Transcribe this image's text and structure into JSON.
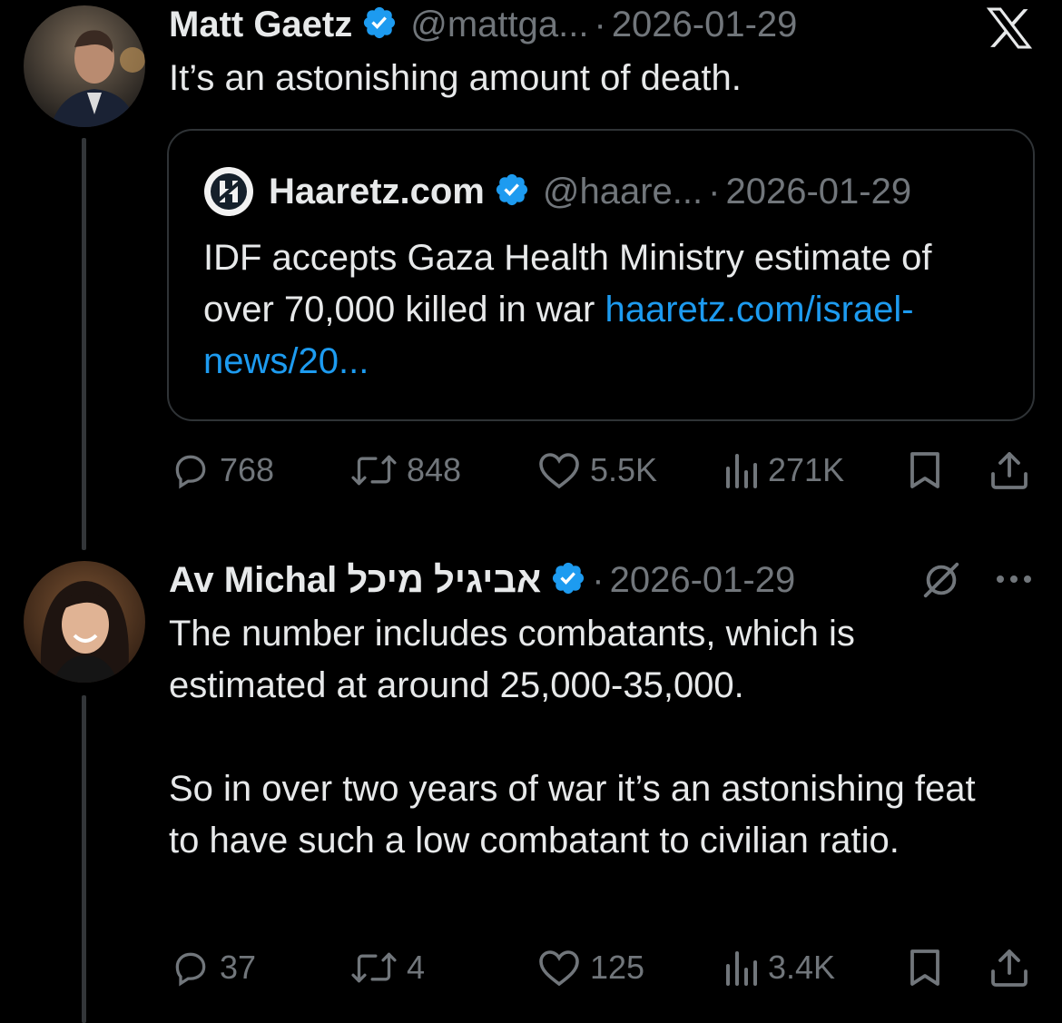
{
  "colors": {
    "background": "#000000",
    "text": "#e7e9ea",
    "muted": "#71767b",
    "link": "#1d9bf0",
    "verified": "#1d9bf0"
  },
  "tweet1": {
    "author_name": "Matt Gaetz",
    "handle": "@mattga...",
    "date": "2026-01-29",
    "text": "It’s an astonishing amount of death.",
    "platform_icon": "x-logo-icon",
    "quote": {
      "author_name": "Haaretz.com",
      "handle": "@haare...",
      "date": "2026-01-29",
      "text": "IDF accepts Gaza Health Ministry estimate of over 70,000 killed in war ",
      "link_text": "haaretz.com/israel-news/20..."
    },
    "metrics": {
      "replies": "768",
      "reposts": "848",
      "likes": "5.5K",
      "views": "271K"
    }
  },
  "tweet2": {
    "author_name": "Av Michal אביגיל מיכל",
    "date": "2026-01-29",
    "text_p1": "The number includes combatants, which is estimated at around 25,000-35,000.",
    "text_p2": "So in over two years of war it’s an astonishing feat to have such a low combatant to civilian ratio.",
    "metrics": {
      "replies": "37",
      "reposts": "4",
      "likes": "125",
      "views": "3.4K"
    }
  }
}
